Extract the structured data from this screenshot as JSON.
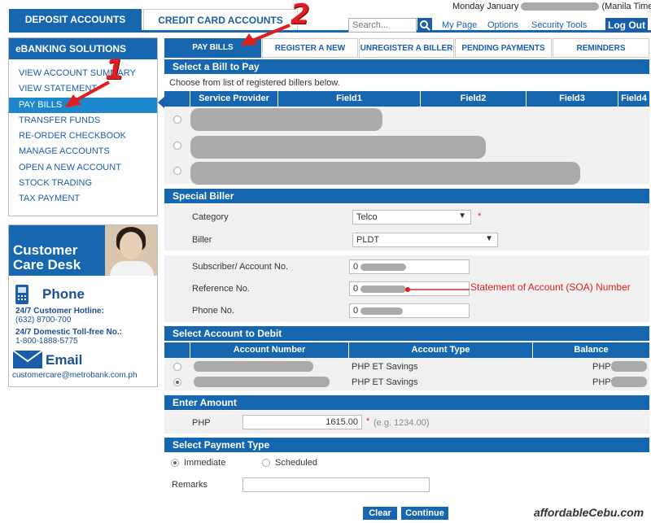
{
  "top_tabs": {
    "deposit": "DEPOSIT ACCOUNTS",
    "credit": "CREDIT CARD ACCOUNTS"
  },
  "header": {
    "date_prefix": "Monday January",
    "timezone": "(Manila Time)",
    "search_placeholder": "Search...",
    "links": [
      "My Page",
      "Options",
      "Security Tools"
    ],
    "logout": "Log Out"
  },
  "sidebar": {
    "title": "eBANKING SOLUTIONS",
    "items": [
      {
        "label": "VIEW ACCOUNT SUMMARY",
        "active": false
      },
      {
        "label": "VIEW STATEMENT",
        "active": false
      },
      {
        "label": "PAY BILLS",
        "active": true
      },
      {
        "label": "TRANSFER FUNDS",
        "active": false
      },
      {
        "label": "RE-ORDER CHECKBOOK",
        "active": false
      },
      {
        "label": "MANAGE ACCOUNTS",
        "active": false
      },
      {
        "label": "OPEN A NEW ACCOUNT",
        "active": false
      },
      {
        "label": "STOCK TRADING",
        "active": false
      },
      {
        "label": "TAX PAYMENT",
        "active": false
      }
    ]
  },
  "care": {
    "title_line1": "Customer",
    "title_line2": "Care Desk",
    "phone_label": "Phone",
    "hotline_label": "24/7 Customer Hotline:",
    "hotline": "(632) 8700-700",
    "tollfree_label": "24/7 Domestic Toll-free No.:",
    "tollfree": "1-800-1888-5775",
    "email_label": "Email",
    "email": "customercare@metrobank.com.ph"
  },
  "main_tabs": [
    "PAY BILLS",
    "REGISTER A NEW BILLER",
    "UNREGISTER A BILLER",
    "PENDING PAYMENTS",
    "REMINDERS"
  ],
  "select_bill": {
    "title": "Select a Bill to Pay",
    "subtitle": "Choose from list of registered billers below.",
    "columns": [
      "Service Provider",
      "Field1",
      "Field2",
      "Field3",
      "Field4"
    ]
  },
  "special_biller": {
    "title": "Special Biller",
    "category_label": "Category",
    "category_value": "Telco",
    "required_mark": "*",
    "biller_label": "Biller",
    "biller_value": "PLDT",
    "subscriber_label": "Subscriber/ Account No.",
    "subscriber_value": "0",
    "reference_label": "Reference No.",
    "reference_value": "0",
    "phone_label": "Phone No.",
    "phone_value": "0",
    "annotation": "Statement of Account (SOA) Number"
  },
  "debit": {
    "title": "Select Account to Debit",
    "columns": [
      "Account Number",
      "Account Type",
      "Balance"
    ],
    "rows": [
      {
        "type": "PHP ET Savings",
        "currency": "PHP",
        "selected": false
      },
      {
        "type": "PHP ET Savings",
        "currency": "PHP",
        "selected": true
      }
    ]
  },
  "amount": {
    "title": "Enter Amount",
    "currency": "PHP",
    "value": "1615.00",
    "required_mark": "*",
    "hint": "(e.g. 1234.00)"
  },
  "payment_type": {
    "title": "Select Payment Type",
    "options": [
      {
        "label": "Immediate",
        "selected": true
      },
      {
        "label": "Scheduled",
        "selected": false
      }
    ],
    "remarks_label": "Remarks"
  },
  "buttons": {
    "clear": "Clear",
    "continue": "Continue"
  },
  "annotations": {
    "one": "1",
    "two": "2"
  },
  "watermark": "affordableCebu.com",
  "colors": {
    "brand_blue": "#1767b0",
    "active_blue": "#1e86cc",
    "annotation_red": "#e01e1e"
  }
}
